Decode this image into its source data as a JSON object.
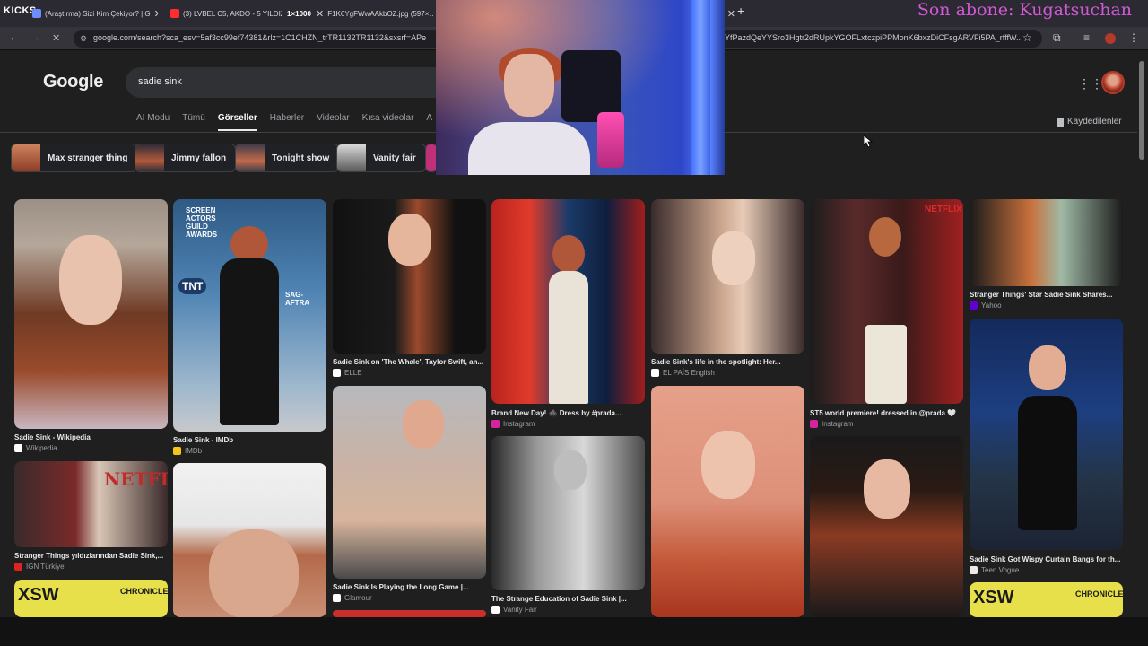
{
  "stream": {
    "brand_logo": "KICKS",
    "overlay_text": "Son abone: Kugatsuchan"
  },
  "browser": {
    "tabs": [
      {
        "title": "(Araştırma) Sizi Kim Çekiyor? | G",
        "favicon_color": "#6e8bff"
      },
      {
        "title": "(3) LVBEL C5, AKDO - 5 YILDIZ",
        "favicon_color": "#ff2d2d"
      },
      {
        "title": "1×1000",
        "favicon_color": "#ffffff"
      },
      {
        "title": "F1K6YgFWwAAkbOZ.jpg (597×…",
        "favicon_color": "#ffffff"
      }
    ],
    "new_tab": "+",
    "url_left": "google.com/search?sca_esv=5af3cc99ef74381&rlz=1C1CHZN_trTR1132TR1132&sxsrf=APe",
    "url_right": "YfPazdQeYYSro3Hgtr2dRUpkYGOFLxtczpiPPMonK6bxzDiCFsgARVFi5PA_rfffW..."
  },
  "google": {
    "logo": "Google",
    "query": "sadie sink",
    "tabs": [
      "AI Modu",
      "Tümü",
      "Görseller",
      "Haberler",
      "Videolar",
      "Kısa videolar",
      "A"
    ],
    "active_tab": "Görseller",
    "saved_label": "Kaydedilenler",
    "chips": [
      {
        "label": "Max stranger thing",
        "color": "#b5604a"
      },
      {
        "label": "Jimmy fallon",
        "color": "#6b5a52"
      },
      {
        "label": "Tonight show",
        "color": "#8a5a4a"
      },
      {
        "label": "Vanity fair",
        "color": "#777777"
      }
    ]
  },
  "results": [
    {
      "caption": "Sadie Sink - Wikipedia",
      "source": "Wikipedia",
      "src_color": "#ffffff"
    },
    {
      "caption": "Sadie Sink - IMDb",
      "source": "IMDb",
      "src_color": "#f5c518"
    },
    {
      "caption": "Sadie Sink on 'The Whale', Taylor Swift, an...",
      "source": "ELLE",
      "src_color": "#ffffff"
    },
    {
      "caption": "Brand New Day! 🕷️ Dress by #prada...",
      "source": "Instagram",
      "src_color": "#d6249f"
    },
    {
      "caption": "Sadie Sink's life in the spotlight: Her...",
      "source": "EL PAÍS English",
      "src_color": "#ffffff"
    },
    {
      "caption": "ST5 world premiere! dressed in @prada 🤍",
      "source": "Instagram",
      "src_color": "#d6249f"
    },
    {
      "caption": "Stranger Things' Star Sadie Sink Shares...",
      "source": "Yahoo",
      "src_color": "#6001d2"
    },
    {
      "caption": "Stranger Things yıldızlarından Sadie Sink,...",
      "source": "IGN Türkiye",
      "src_color": "#d22"
    },
    {
      "caption": "Sadie Sink Is Playing the Long Game |...",
      "source": "Glamour",
      "src_color": "#ffffff"
    },
    {
      "caption": "The Strange Education of Sadie Sink |...",
      "source": "Vanity Fair",
      "src_color": "#ffffff"
    },
    {
      "caption": "Sadie Sink Got Wispy Curtain Bangs for th...",
      "source": "Teen Vogue",
      "src_color": "#e9e9e9"
    }
  ],
  "image_text": {
    "sag_awards": "SCREEN ACTORS GUILD AWARDS",
    "tnt": "TNT",
    "sag_aftra": "SAG-AFTRA",
    "netflix": "NETFLIX",
    "sxsw": "XSW",
    "chronicle": "CHRONICLE"
  }
}
